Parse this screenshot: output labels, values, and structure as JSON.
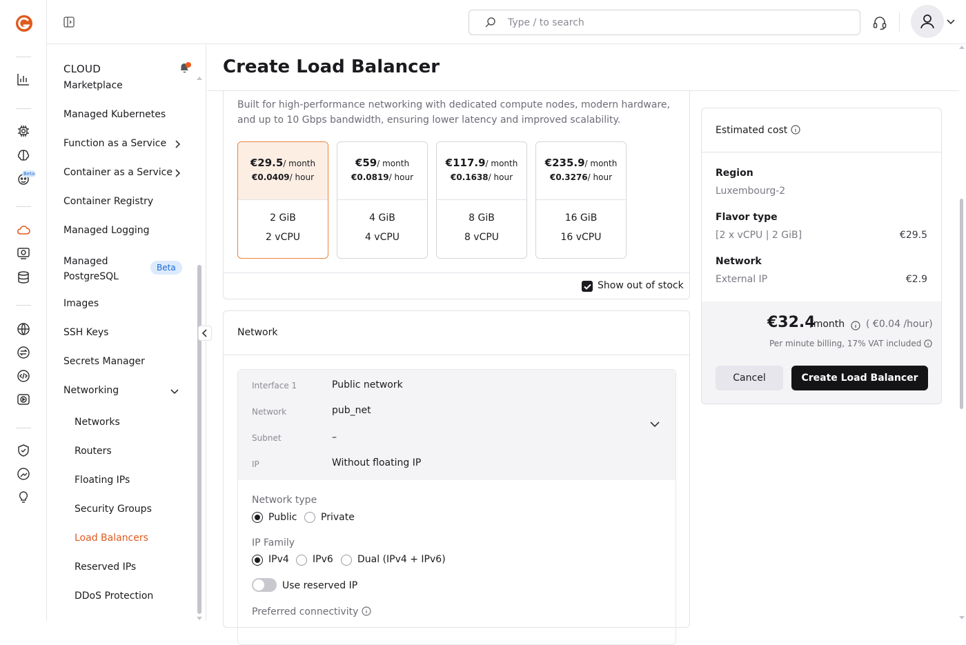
{
  "brand": {
    "accent": "#e05a1c",
    "primary_button": "#141416",
    "selected_border": "#e8833e",
    "selected_bg": "#fdeee4"
  },
  "rail": {
    "icons": [
      "logo-icon",
      "analytics-icon",
      "chip-icon",
      "brain-icon",
      "robot-icon",
      "cloud-icon",
      "server-icon",
      "database-icon",
      "globe-icon",
      "transfer-icon",
      "code-icon",
      "play-icon",
      "shield-check-icon",
      "support-icon",
      "lightbulb-icon"
    ],
    "beta_label": "Beta"
  },
  "topbar": {
    "search_placeholder": "Type / to search"
  },
  "sidebar": {
    "section_title": "CLOUD",
    "items": [
      {
        "label": "Marketplace"
      },
      {
        "label": "Managed Kubernetes"
      },
      {
        "label": "Function as a Service"
      },
      {
        "label": "Container as a Service"
      },
      {
        "label": "Container Registry"
      },
      {
        "label": "Managed Logging"
      },
      {
        "label": "Managed PostgreSQL",
        "badge": "Beta"
      },
      {
        "label": "Images"
      },
      {
        "label": "SSH Keys"
      },
      {
        "label": "Secrets Manager"
      },
      {
        "label": "Networking"
      }
    ],
    "networking_sub": [
      {
        "label": "Networks"
      },
      {
        "label": "Routers"
      },
      {
        "label": "Floating IPs"
      },
      {
        "label": "Security Groups"
      },
      {
        "label": "Load Balancers",
        "active": true
      },
      {
        "label": "Reserved IPs"
      },
      {
        "label": "DDoS Protection"
      }
    ]
  },
  "page": {
    "title": "Create Load Balancer",
    "flavor_description": "Built for high-performance networking with dedicated compute nodes, modern hardware, and up to 10 Gbps bandwidth, ensuring lower latency and improved scalability.",
    "flavors": [
      {
        "price": "€29.5",
        "per_month": "/ month",
        "hourly": "€0.0409",
        "per_hour": "/ hour",
        "ram": "2 GiB",
        "cpu": "2 vCPU",
        "selected": true
      },
      {
        "price": "€59",
        "per_month": "/ month",
        "hourly": "€0.0819",
        "per_hour": "/ hour",
        "ram": "4 GiB",
        "cpu": "4 vCPU",
        "selected": false
      },
      {
        "price": "€117.9",
        "per_month": "/ month",
        "hourly": "€0.1638",
        "per_hour": "/ hour",
        "ram": "8 GiB",
        "cpu": "8 vCPU",
        "selected": false
      },
      {
        "price": "€235.9",
        "per_month": "/ month",
        "hourly": "€0.3276",
        "per_hour": "/ hour",
        "ram": "16 GiB",
        "cpu": "16 vCPU",
        "selected": false
      }
    ],
    "show_out_of_stock": "Show out of stock",
    "network": {
      "title": "Network",
      "interface": [
        {
          "label": "Interface 1",
          "value": "Public network"
        },
        {
          "label": "Network",
          "value": "pub_net"
        },
        {
          "label": "Subnet",
          "value": "–"
        },
        {
          "label": "IP",
          "value": "Without floating IP"
        }
      ],
      "network_type_label": "Network type",
      "network_type_options": [
        "Public",
        "Private"
      ],
      "ip_family_label": "IP Family",
      "ip_family_options": [
        "IPv4",
        "IPv6",
        "Dual (IPv4 + IPv6)"
      ],
      "reserved_ip_label": "Use reserved IP",
      "preferred_connectivity_label": "Preferred connectivity"
    }
  },
  "cost": {
    "title": "Estimated cost",
    "region_label": "Region",
    "region_value": "Luxembourg-2",
    "flavor_label": "Flavor type",
    "flavor_value": "[2 x vCPU | 2 GiB]",
    "flavor_price": "€29.5",
    "network_label": "Network",
    "network_value": "External IP",
    "network_price": "€2.9",
    "total": "€32.4",
    "total_per": "/month",
    "total_hourly": "( €0.04 /hour)",
    "billing_note": "Per minute billing, 17% VAT included",
    "cancel": "Cancel",
    "create": "Create Load Balancer"
  }
}
